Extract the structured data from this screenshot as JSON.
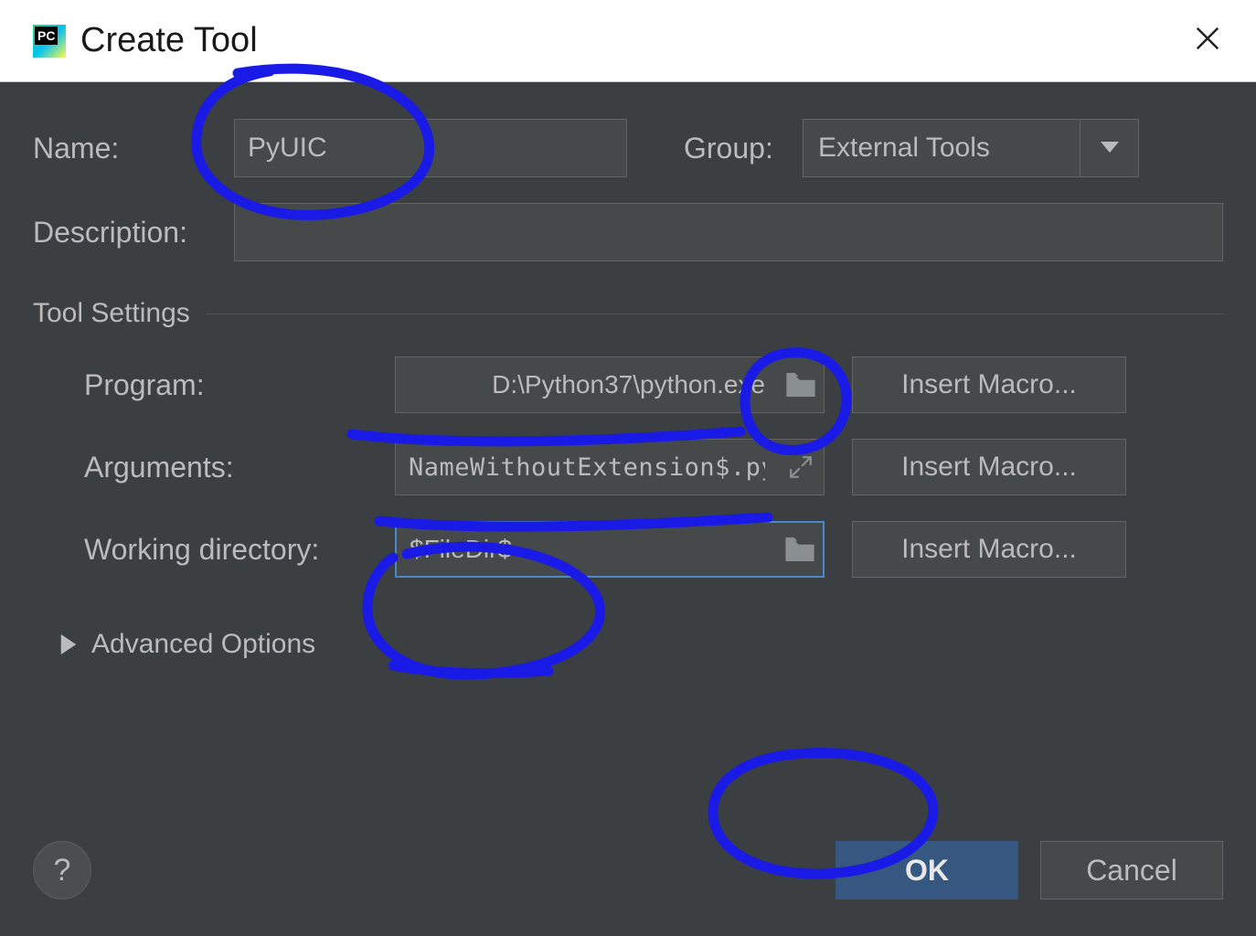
{
  "window": {
    "title": "Create Tool"
  },
  "fields": {
    "name_label": "Name:",
    "name_value": "PyUIC",
    "group_label": "Group:",
    "group_value": "External Tools",
    "description_label": "Description:",
    "description_value": ""
  },
  "tool_settings": {
    "section_title": "Tool Settings",
    "program_label": "Program:",
    "program_value": "D:\\Python37\\python.exe",
    "arguments_label": "Arguments:",
    "arguments_value": "NameWithoutExtension$.py",
    "workdir_label": "Working directory:",
    "workdir_value": "$FileDir$",
    "insert_macro_label": "Insert Macro..."
  },
  "advanced": {
    "label": "Advanced Options"
  },
  "footer": {
    "help_label": "?",
    "ok_label": "OK",
    "cancel_label": "Cancel"
  },
  "icons": {
    "close": "close-icon",
    "chevron_down": "chevron-down-icon",
    "folder": "folder-icon",
    "expand": "expand-icon",
    "triangle_right": "triangle-right-icon"
  }
}
